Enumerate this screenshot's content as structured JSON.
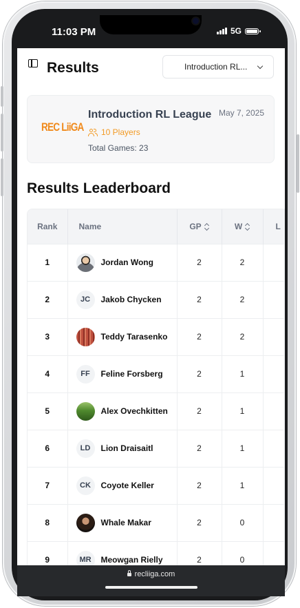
{
  "status_bar": {
    "time": "11:03 PM",
    "network": "5G"
  },
  "header": {
    "title": "Results",
    "league_select": "Introduction RL..."
  },
  "league_card": {
    "logo_text": "REC LiiGA",
    "title": "Introduction RL League",
    "date": "May 7, 2025",
    "players": "10 Players",
    "total_games": "Total Games: 23"
  },
  "leaderboard": {
    "title": "Results Leaderboard",
    "columns": {
      "rank": "Rank",
      "name": "Name",
      "gp": "GP",
      "w": "W",
      "more": "L"
    },
    "rows": [
      {
        "rank": "1",
        "name": "Jordan Wong",
        "initials": "",
        "avatar": "photo-person",
        "gp": "2",
        "w": "2"
      },
      {
        "rank": "2",
        "name": "Jakob Chycken",
        "initials": "JC",
        "avatar": "initials",
        "gp": "2",
        "w": "2"
      },
      {
        "rank": "3",
        "name": "Teddy Tarasenko",
        "initials": "",
        "avatar": "photo-red",
        "gp": "2",
        "w": "2"
      },
      {
        "rank": "4",
        "name": "Feline Forsberg",
        "initials": "FF",
        "avatar": "initials",
        "gp": "2",
        "w": "1"
      },
      {
        "rank": "5",
        "name": "Alex Ovechkitten",
        "initials": "",
        "avatar": "photo-green",
        "gp": "2",
        "w": "1"
      },
      {
        "rank": "6",
        "name": "Lion Draisaitl",
        "initials": "LD",
        "avatar": "initials",
        "gp": "2",
        "w": "1"
      },
      {
        "rank": "7",
        "name": "Coyote Keller",
        "initials": "CK",
        "avatar": "initials",
        "gp": "2",
        "w": "1"
      },
      {
        "rank": "8",
        "name": "Whale Makar",
        "initials": "",
        "avatar": "photo-dark",
        "gp": "2",
        "w": "0"
      },
      {
        "rank": "9",
        "name": "Meowgan Rielly",
        "initials": "MR",
        "avatar": "initials",
        "gp": "2",
        "w": "0"
      }
    ]
  },
  "browser": {
    "url": "recliiga.com"
  }
}
